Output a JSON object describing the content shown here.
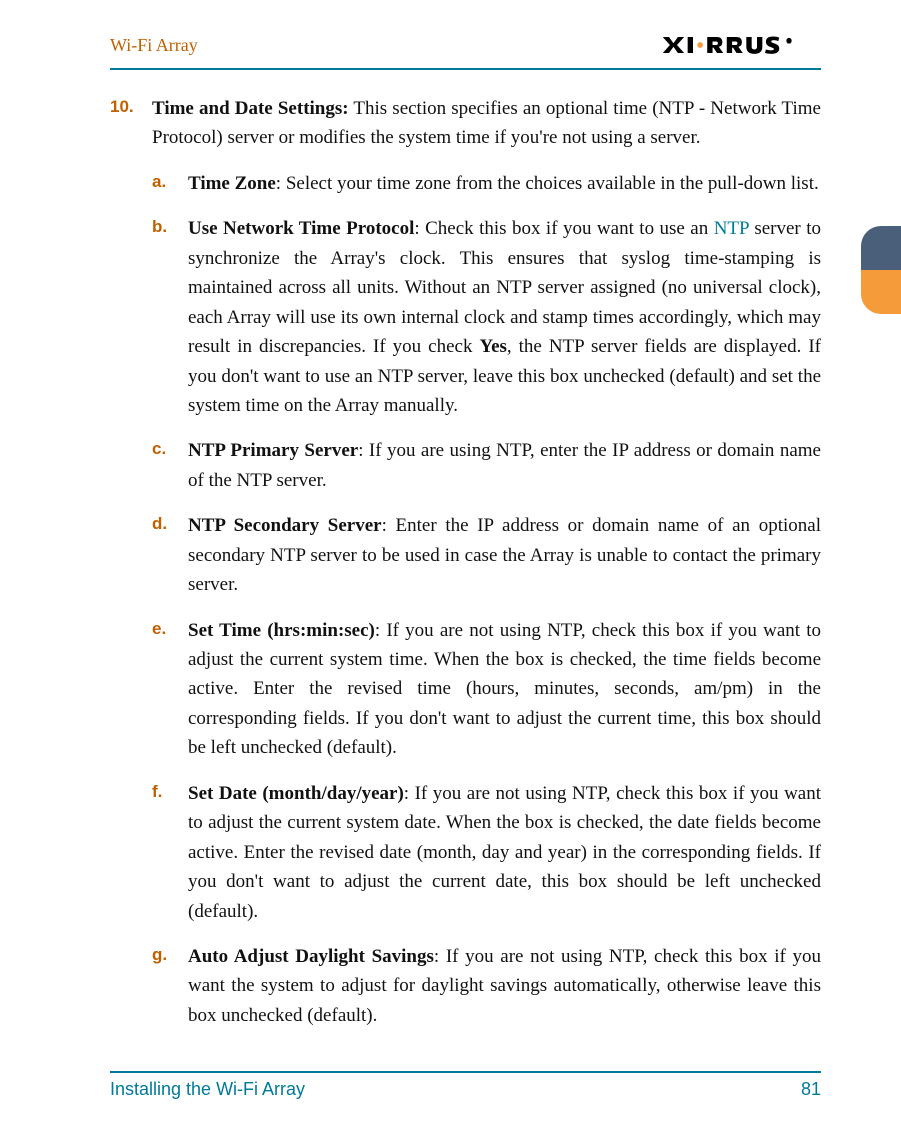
{
  "header": {
    "title": "Wi-Fi Array",
    "brand_alt": "XIRRUS"
  },
  "step": {
    "num": "10.",
    "title": "Time and Date Settings:",
    "desc": "This section specifies an optional time (NTP - Network Time Protocol) server or modifies the system time if you're not using a server."
  },
  "subs": {
    "a": {
      "letter": "a.",
      "title": "Time Zone",
      "text": ": Select your time zone from the choices available in the pull-down list."
    },
    "b": {
      "letter": "b.",
      "title": "Use Network Time Protocol",
      "pre": ": Check this box if you want to use an ",
      "ntp": "NTP",
      "post1": " server to synchronize the Array's clock. This ensures that syslog time-stamping is maintained across all units. Without an NTP server assigned (no universal clock), each Array will use its own internal clock and stamp times accordingly, which may result in discrepancies. If you check ",
      "yes": "Yes",
      "post2": ", the NTP server fields are displayed. If you don't want to use an NTP server, leave this box unchecked (default) and set the system time on the Array manually."
    },
    "c": {
      "letter": "c.",
      "title": "NTP Primary Server",
      "text": ": If you are using NTP, enter the IP address or domain name of the NTP server."
    },
    "d": {
      "letter": "d.",
      "title": "NTP Secondary Server",
      "text": ": Enter the IP address or domain name of an optional secondary NTP server to be used in case the Array is unable to contact the primary server."
    },
    "e": {
      "letter": "e.",
      "title": "Set Time (hrs:min:sec)",
      "text": ": If you are not using NTP, check this box if you want to adjust the current system time. When the box is checked, the time fields become active. Enter the revised time (hours, minutes, seconds, am/pm) in the corresponding fields. If you don't want to adjust the current time, this box should be left unchecked (default)."
    },
    "f": {
      "letter": "f.",
      "title": "Set Date (month/day/year)",
      "text": ": If you are not using NTP, check this box if you want to adjust the current system date. When the box is checked, the date fields become active. Enter the revised date (month, day and year) in the corresponding fields. If you don't want to adjust the current date, this box should be left unchecked (default)."
    },
    "g": {
      "letter": "g.",
      "title": "Auto Adjust Daylight Savings",
      "text": ": If you are not using NTP, check this box if you want the system to adjust for daylight savings automatically, otherwise leave this box unchecked (default)."
    }
  },
  "footer": {
    "section": "Installing the Wi-Fi Array",
    "page": "81"
  }
}
